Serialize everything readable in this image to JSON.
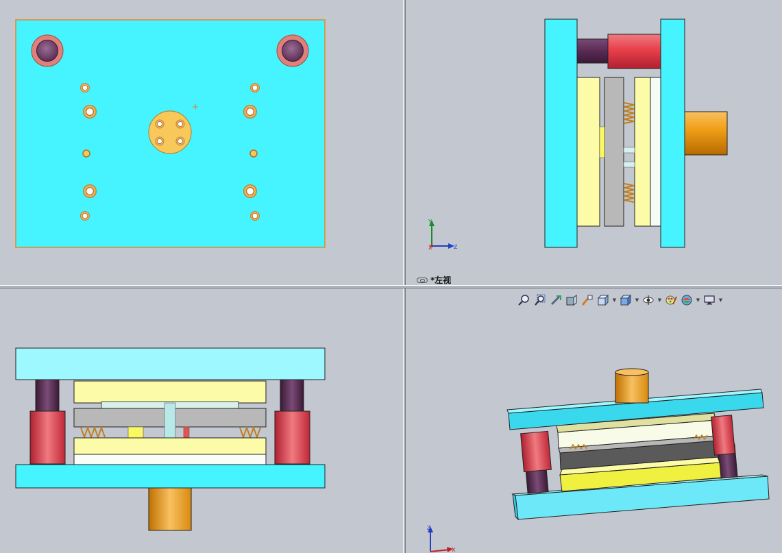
{
  "views": {
    "top_right": {
      "label": "*左视"
    }
  },
  "triad": {
    "y": "Y",
    "z": "Z",
    "x": "X"
  },
  "toolbar": {
    "buttons": [
      {
        "name": "zoom-to-fit-icon"
      },
      {
        "name": "zoom-to-area-icon"
      },
      {
        "name": "previous-view-icon"
      },
      {
        "name": "section-view-icon"
      },
      {
        "name": "dynamic-annotation-icon"
      },
      {
        "name": "view-orientation-icon"
      },
      {
        "name": "display-style-icon"
      },
      {
        "name": "hide-show-items-icon"
      },
      {
        "name": "edit-appearance-icon"
      },
      {
        "name": "apply-scene-icon"
      },
      {
        "name": "view-settings-icon"
      }
    ]
  },
  "colors": {
    "background": "#c3c7d0",
    "plate_cyan": "#45f4ff",
    "plate_light_cyan": "#9ef8ff",
    "yellow_plate": "#fbfba8",
    "gray_plate": "#b8b8b8",
    "bushing_red": "#e8404a",
    "guide_post_purple": "#5a2a55",
    "shank_orange": "#f0a018",
    "outline_orange": "#e08a2a"
  }
}
